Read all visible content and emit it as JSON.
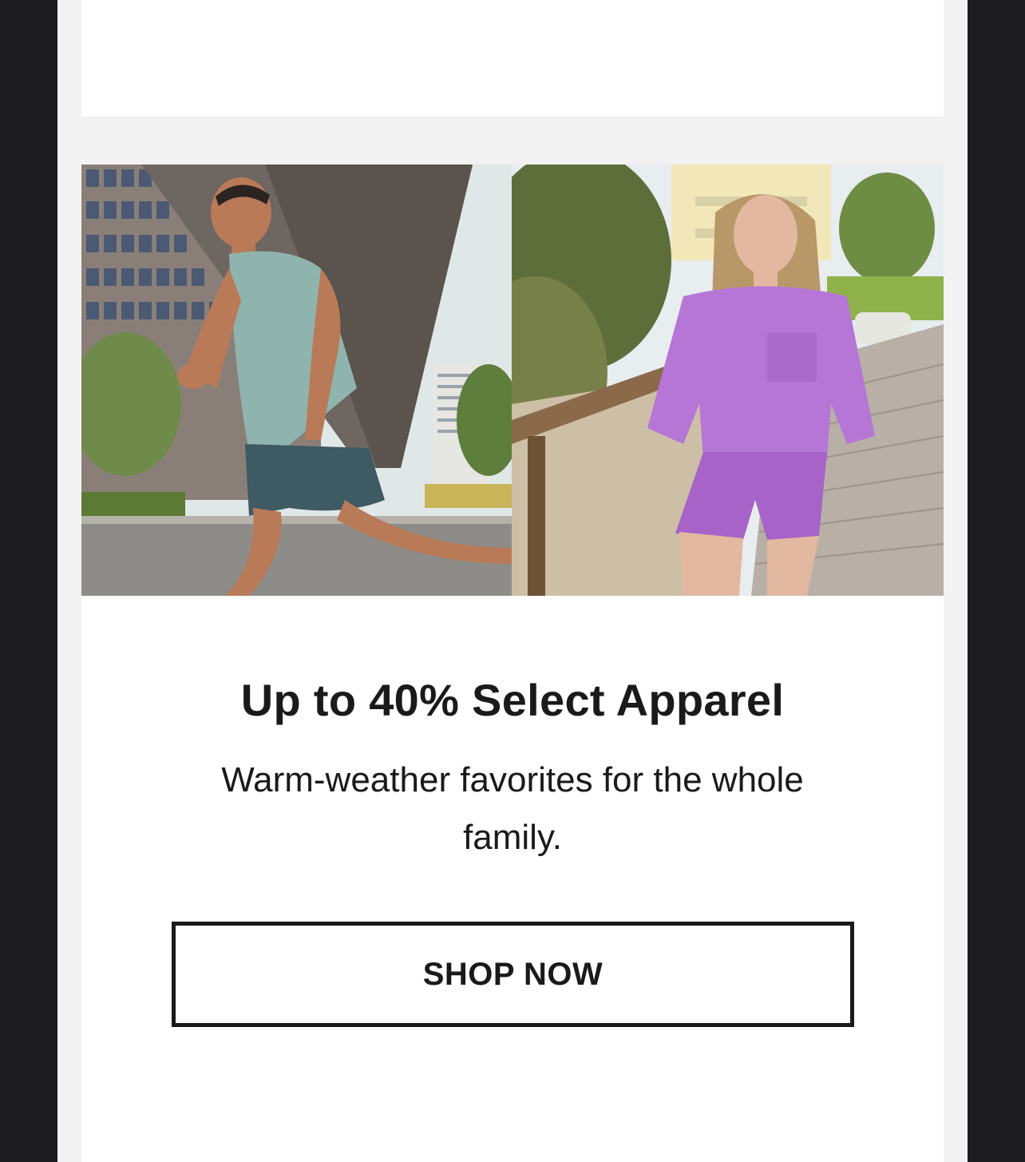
{
  "promo": {
    "headline": "Up to 40% Select Apparel",
    "subtext": "Warm-weather favorites for the whole family.",
    "cta_label": "SHOP NOW"
  },
  "images": {
    "left": "man-running-photo",
    "right": "woman-boardwalk-photo"
  },
  "colors": {
    "page_background": "#1c1c1e",
    "frame_background": "#f2f2f2",
    "card_background": "#ffffff",
    "text": "#1a1a1a"
  }
}
